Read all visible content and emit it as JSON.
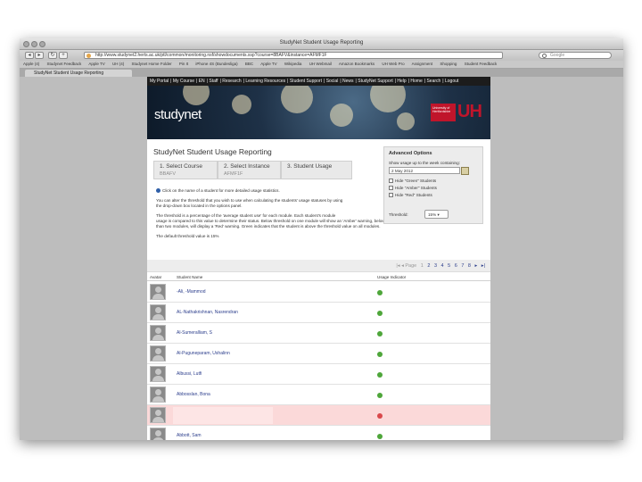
{
  "window": {
    "title": "StudyNet Student Usage Reporting",
    "url": "http://www.studynet2.herts.ac.uk/ptl/common/monitoring.nsf/showdocuments.xsp?course=8BAFV&instance=AFMF1F",
    "search_placeholder": "Google",
    "tab_title": "StudyNet Student Usage Reporting",
    "bookmarks": [
      "Apple (4)",
      "Studynet Feedback",
      "Apple TV",
      "UH (4)",
      "Studynet Home Folder",
      "Pin It",
      "iPhone 4S (Bundesliga)",
      "BBC",
      "Apple TV",
      "Wikipedia",
      "UH Webmail",
      "Amazon Bookmarks",
      "UH Web Pro",
      "Assignment",
      "Shopping",
      "Student Feedback"
    ]
  },
  "site": {
    "nav": [
      "My Portal",
      "My Course",
      "EN",
      "Staff",
      "Research",
      "Learning Resources",
      "Student Support",
      "Social",
      "News",
      "StudyNet Support",
      "Help",
      "Home",
      "Search",
      "Logout"
    ],
    "logo": "studynet",
    "uni_box": "University of Hertfordshire",
    "uni_mark": "UH"
  },
  "page": {
    "title": "StudyNet Student Usage Reporting",
    "steps": [
      {
        "title": "1. Select Course",
        "sub": "BBAFV"
      },
      {
        "title": "2. Select Instance",
        "sub": "AFMF1F"
      },
      {
        "title": "3. Student Usage",
        "sub": ""
      }
    ],
    "info": {
      "line1": "Click on the name of a student for more detailed usage statistics.",
      "line2": "You can alter the threshold that you wish to use when calculating the students' usage statuses by using",
      "line3": "the drop-down box located in the options panel.",
      "line4": "The threshold is a percentage of the 'average student use' for each module. Each student's module",
      "line5": "usage is compared to this value to determine their status. Below threshold on one module will show an 'Amber' warning, below threshold on all, or more",
      "line6": "than two modules, will display a 'Red' warning. Green indicates that the student is above the threshold value on all modules.",
      "line7": "The default threshold value is 15%"
    },
    "options": {
      "title": "Advanced Options",
      "week_label": "Show usage up to the week containing:",
      "date": "2 May 2012",
      "hide_green": "Hide \"Green\" Students",
      "hide_amber": "Hide \"Amber\" Students",
      "hide_red": "Hide \"Red\" Students",
      "threshold_label": "Threshold:",
      "threshold_value": "15%"
    },
    "pager": {
      "label": "Page",
      "current": "1",
      "pages": [
        "2",
        "3",
        "4",
        "5",
        "6",
        "7",
        "8"
      ]
    },
    "table": {
      "col_avatar": "Avatar",
      "col_name": "Student Name",
      "col_usage": "Usage Indicator",
      "rows": [
        {
          "name": "-Ali, -Mammod",
          "status": "green"
        },
        {
          "name": "AL-Nathakrishnan, Nasrendran",
          "status": "green"
        },
        {
          "name": "Al-Sumeralliam, S",
          "status": "green"
        },
        {
          "name": "Al-Puguneparam, Ushalinn",
          "status": "green"
        },
        {
          "name": "Albussi, Lutfi",
          "status": "green"
        },
        {
          "name": "Abbosslan, Bona",
          "status": "green"
        },
        {
          "name": "",
          "status": "red"
        },
        {
          "name": "Abbott, Sam",
          "status": "green"
        }
      ]
    }
  },
  "colors": {
    "link": "#2c3e8c",
    "status_green": "#4ea63a",
    "status_red": "#d9484b",
    "row_red": "#fbd9d9",
    "brand_red": "#c0152b"
  }
}
